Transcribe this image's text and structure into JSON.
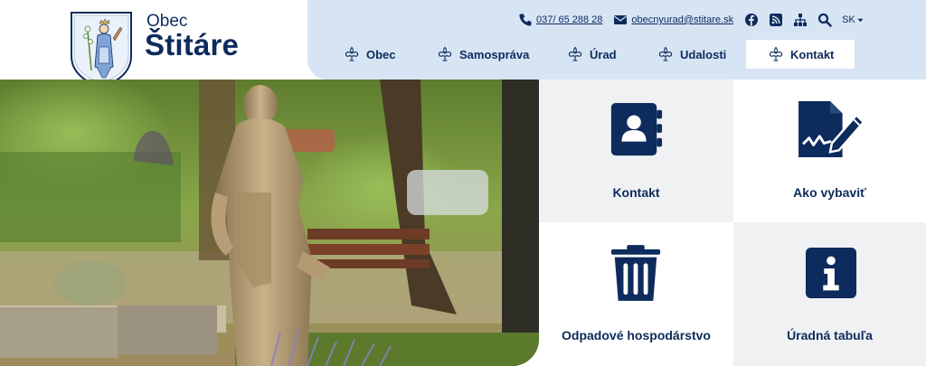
{
  "brand": {
    "small": "Obec",
    "big": "Štitáre"
  },
  "utility": {
    "phone": "037/ 65 288 28",
    "email": "obecnyurad@stitare.sk",
    "language": "SK"
  },
  "nav": {
    "items": [
      {
        "label": "Obec"
      },
      {
        "label": "Samospráva"
      },
      {
        "label": "Úrad"
      },
      {
        "label": "Udalosti"
      },
      {
        "label": "Kontakt"
      }
    ],
    "active_index": 4
  },
  "tiles": [
    {
      "label": "Kontakt",
      "icon": "address-book-icon"
    },
    {
      "label": "Ako vybaviť",
      "icon": "signature-document-icon"
    },
    {
      "label": "Odpadové hospodárstvo",
      "icon": "trash-can-icon"
    },
    {
      "label": "Úradná tabuľa",
      "icon": "info-icon"
    }
  ],
  "colors": {
    "navy": "#0d2b5c",
    "topbar": "#d6e4f4",
    "tile_light": "#f0f1f3",
    "white": "#ffffff"
  }
}
